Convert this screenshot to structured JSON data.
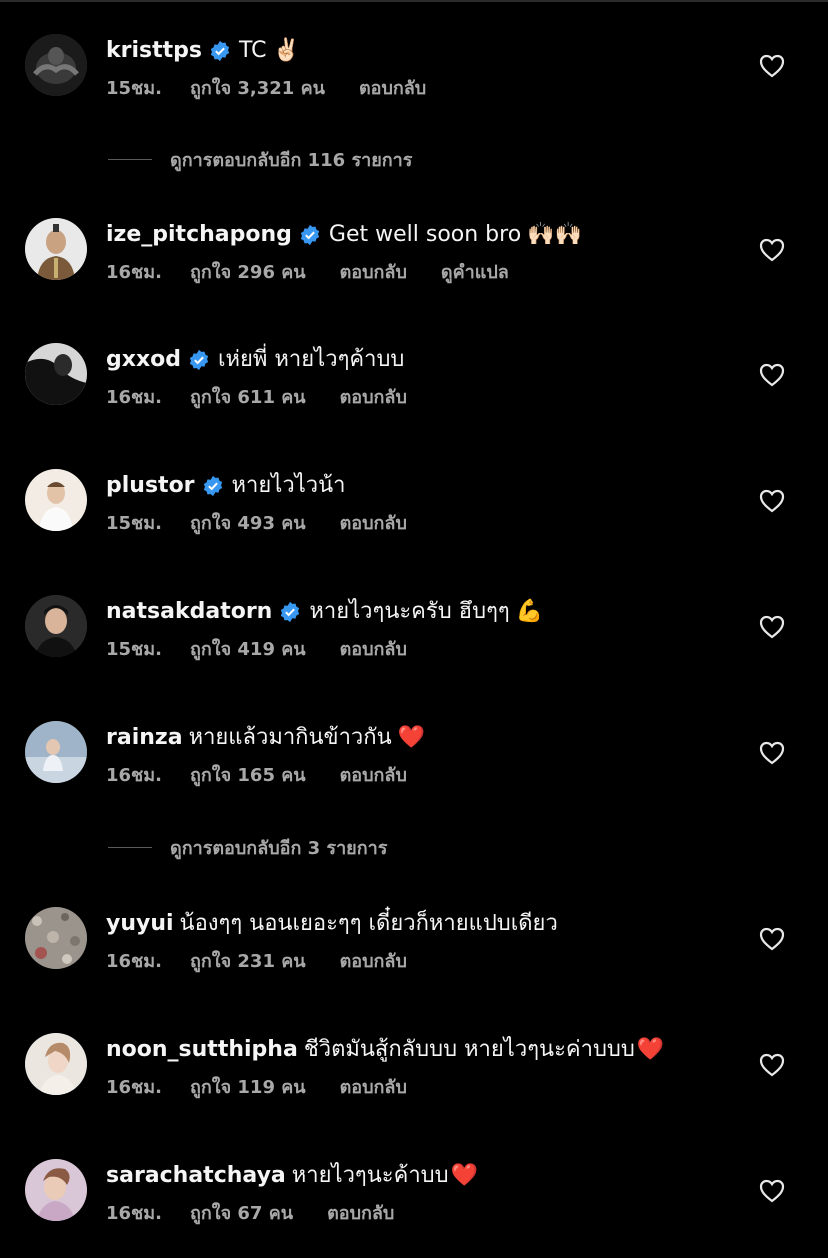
{
  "colors": {
    "background": "#000000",
    "text_primary": "#f5f5f5",
    "text_secondary": "#a8a8a8",
    "verified": "#3897f0",
    "heart_red": "#e0245e"
  },
  "comments": [
    {
      "username": "kristtps",
      "verified": true,
      "text": "TC",
      "emoji": "✌🏻",
      "time": "15ชม.",
      "likes": "ถูกใจ 3,321 คน",
      "reply": "ตอบกลับ",
      "translate": ""
    },
    {
      "username": "ize_pitchapong",
      "verified": true,
      "text": "Get well soon bro",
      "emoji": "🙌🏻🙌🏻",
      "time": "16ชม.",
      "likes": "ถูกใจ 296 คน",
      "reply": "ตอบกลับ",
      "translate": "ดูคำแปล"
    },
    {
      "username": "gxxod",
      "verified": true,
      "text": "เห่ยพี่ หายไวๆค้าบบ",
      "emoji": "",
      "time": "16ชม.",
      "likes": "ถูกใจ 611 คน",
      "reply": "ตอบกลับ",
      "translate": ""
    },
    {
      "username": "plustor",
      "verified": true,
      "text": "หายไวไวน้า",
      "emoji": "",
      "time": "15ชม.",
      "likes": "ถูกใจ 493 คน",
      "reply": "ตอบกลับ",
      "translate": ""
    },
    {
      "username": "natsakdatorn",
      "verified": true,
      "text": "หายไวๆนะครับ ฮึบๆๆ",
      "emoji": "💪",
      "time": "15ชม.",
      "likes": "ถูกใจ 419 คน",
      "reply": "ตอบกลับ",
      "translate": ""
    },
    {
      "username": "rainza",
      "verified": false,
      "text": "หายแล้วมากินข้าวกัน",
      "emoji": "❤️",
      "time": "16ชม.",
      "likes": "ถูกใจ 165 คน",
      "reply": "ตอบกลับ",
      "translate": ""
    },
    {
      "username": "yuyui",
      "verified": false,
      "text": "น้องๆๆ นอนเยอะๆๆ เดี๋ยวก็หายแปบเดียว",
      "emoji": "",
      "time": "16ชม.",
      "likes": "ถูกใจ 231 คน",
      "reply": "ตอบกลับ",
      "translate": ""
    },
    {
      "username": "noon_sutthipha",
      "verified": false,
      "text": "ชีวิตมันสู้กลับบบ หายไวๆนะค่าบบบ",
      "emoji": "❤️",
      "time": "16ชม.",
      "likes": "ถูกใจ 119 คน",
      "reply": "ตอบกลับ",
      "translate": ""
    },
    {
      "username": "sarachatchaya",
      "verified": false,
      "text": "หายไวๆนะค้าบบ",
      "emoji": "❤️",
      "time": "16ชม.",
      "likes": "ถูกใจ 67 คน",
      "reply": "ตอบกลับ",
      "translate": ""
    }
  ],
  "view_more": [
    {
      "label": "ดูการตอบกลับอีก 116 รายการ"
    },
    {
      "label": "ดูการตอบกลับอีก 3 รายการ"
    }
  ]
}
